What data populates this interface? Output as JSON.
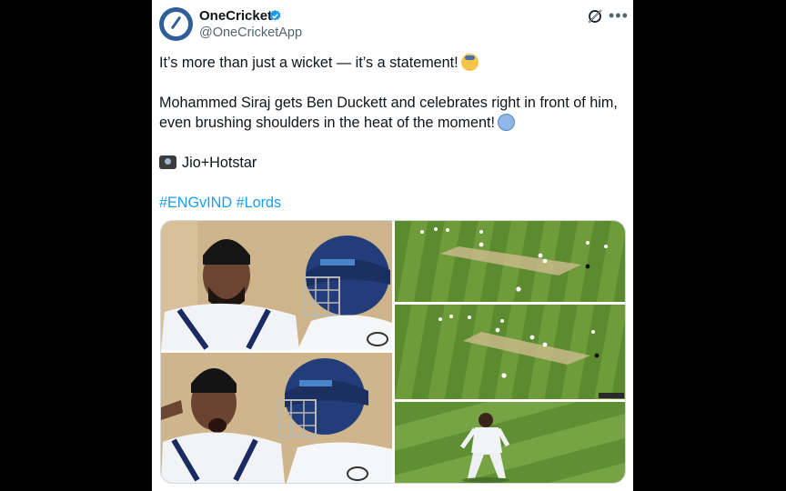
{
  "account": {
    "display_name": "OneCricket",
    "handle": "@OneCricketApp"
  },
  "post": {
    "line1": "It’s more than just a wicket — it’s a statement!",
    "line2": "Mohammed Siraj gets Ben Duckett and celebrates right in front of him,",
    "line3": "even brushing shoulders in the heat of the moment!",
    "credit": "Jio+Hotstar",
    "hashtags": [
      "#ENGvIND",
      "#Lords"
    ]
  },
  "icons": {
    "verified": "verified-badge-icon",
    "grok": "grok-icon",
    "more": "more-options-icon",
    "emoji1": "saluting-face-emoji",
    "emoji2": "flexed-biceps-emoji",
    "camera": "camera-emoji"
  },
  "colors": {
    "link": "#1d9bf0",
    "verified": "#1d9bf0",
    "brand": "#2f5f96",
    "secondary_text": "#536471"
  },
  "media": {
    "panels": [
      "siraj-celebration-closeup-1",
      "aerial-field-view-1",
      "aerial-field-view-2",
      "siraj-celebration-closeup-2",
      "fielder-closeup"
    ]
  }
}
